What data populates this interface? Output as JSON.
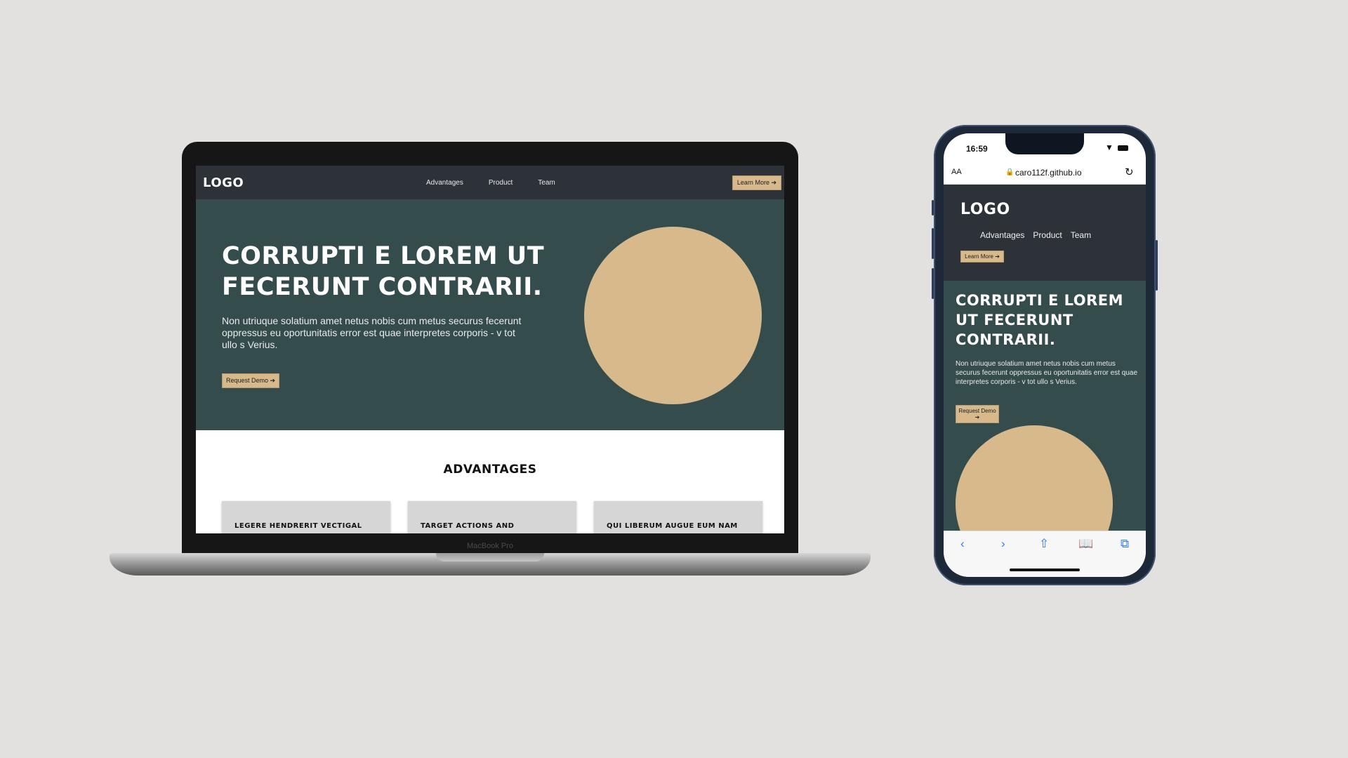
{
  "desktop": {
    "logo": "LOGO",
    "nav_links": [
      "Advantages",
      "Product",
      "Team"
    ],
    "cta": "Learn More ➔",
    "hero": {
      "title": "CORRUPTI E LOREM UT FECERUNT CONTRARII.",
      "body": "Non utriuque solatium amet netus nobis cum metus securus fecerunt oppressus eu oportunitatis error est quae interpretes corporis - v tot ullo s Verius.",
      "button": "Request Demo ➔"
    },
    "advantages": {
      "heading": "ADVANTAGES",
      "cards": [
        "LEGERE HENDRERIT VECTIGAL",
        "TARGET ACTIONS AND",
        "QUI LIBERUM AUGUE EUM NAM"
      ]
    },
    "device_label": "MacBook Pro"
  },
  "mobile": {
    "status_time": "16:59",
    "url_aa": "AA",
    "url": "caro112f.github.io",
    "logo": "LOGO",
    "nav_links": [
      "Advantages",
      "Product",
      "Team"
    ],
    "cta": "Learn More ➔",
    "hero": {
      "title": "CORRUPTI E LOREM UT FECERUNT CONTRARII.",
      "body": "Non utriuque solatium amet netus nobis cum metus securus fecerunt oppressus eu oportunitatis error est quae interpretes corporis - v tot ullo s Verius.",
      "button": "Request Demo ➔"
    },
    "toolbar_icons": [
      "back-icon",
      "forward-icon",
      "share-icon",
      "bookmarks-icon",
      "tabs-icon"
    ]
  },
  "colors": {
    "background": "#e2e1df",
    "nav": "#2c3238",
    "hero": "#354c4d",
    "accent": "#d7b98c",
    "card": "#d6d6d6"
  }
}
